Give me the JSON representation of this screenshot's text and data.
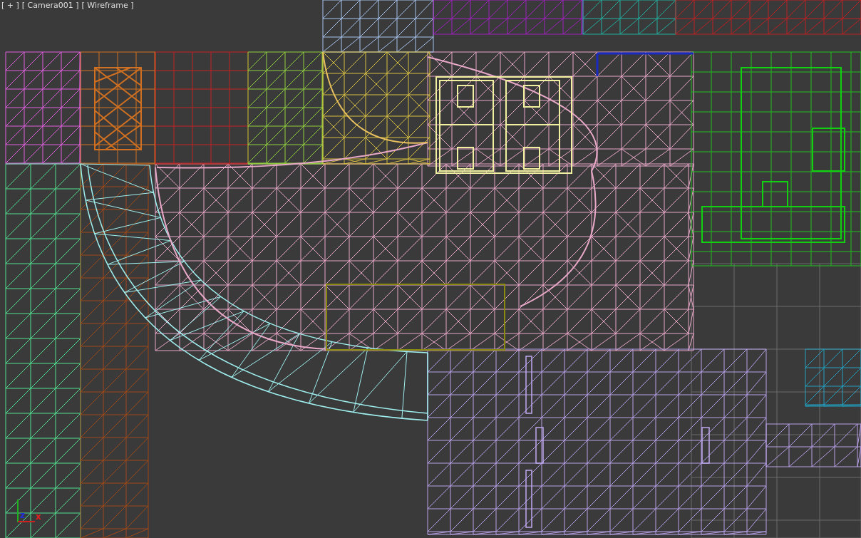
{
  "viewport": {
    "labels": [
      {
        "text": "[ + ]"
      },
      {
        "text": "[ Camera001 ]"
      },
      {
        "text": "[ Wireframe ]"
      }
    ],
    "axis_labels": [
      {
        "text": "z"
      },
      {
        "text": "x"
      }
    ]
  }
}
